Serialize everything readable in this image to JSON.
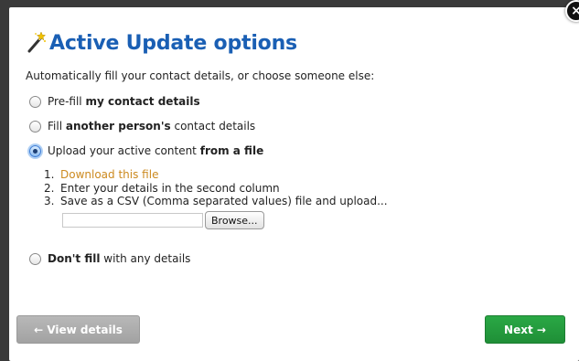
{
  "dialog": {
    "title": "Active Update options",
    "subtitle": "Automatically fill your contact details, or choose someone else:",
    "close_label": "×"
  },
  "options": [
    {
      "pre": "Pre-fill ",
      "bold": "my contact details",
      "post": "",
      "checked": false
    },
    {
      "pre": "Fill ",
      "bold": "another person's",
      "post": " contact details",
      "checked": false
    },
    {
      "pre": "Upload your active content ",
      "bold": "from a file",
      "post": "",
      "checked": true
    },
    {
      "pre": "",
      "bold": "Don't fill",
      "post": " with any details",
      "checked": false
    }
  ],
  "steps": [
    {
      "num": "1.",
      "text": "Download this file",
      "is_link": true
    },
    {
      "num": "2.",
      "text": "Enter your details in the second column",
      "is_link": false
    },
    {
      "num": "3.",
      "text": "Save as a CSV (Comma separated values) file and upload...",
      "is_link": false
    }
  ],
  "file_upload": {
    "value": "",
    "browse_label": "Browse..."
  },
  "footer": {
    "back_label": "← View details",
    "next_label": "Next →"
  },
  "colors": {
    "title": "#1a5fb4",
    "link": "#cc8a1f",
    "next_button": "#2aa845",
    "back_button": "#b0b0b0"
  },
  "icons": {
    "title_icon": "magic-wand-icon"
  }
}
